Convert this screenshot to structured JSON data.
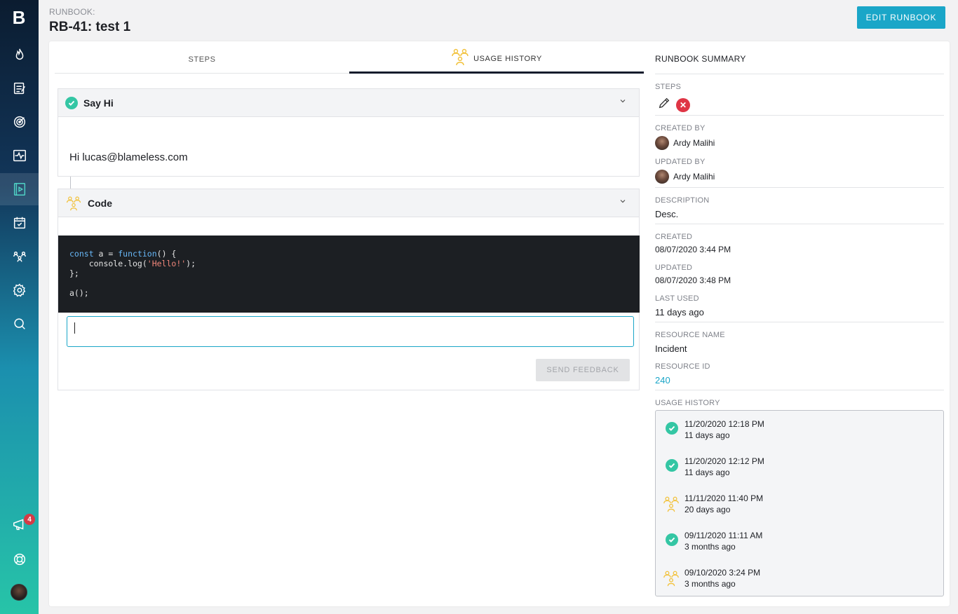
{
  "colors": {
    "accent": "#1aa6c8",
    "success": "#34c6a4",
    "danger": "#df3545",
    "warning_icon": "#f2c23c"
  },
  "sidebar": {
    "logo": "B",
    "items": [
      {
        "icon": "flame-icon"
      },
      {
        "icon": "notes-icon"
      },
      {
        "icon": "target-icon"
      },
      {
        "icon": "pulse-icon"
      },
      {
        "icon": "runbook-icon",
        "active": true
      },
      {
        "icon": "calendar-check-icon"
      },
      {
        "icon": "team-icon"
      },
      {
        "icon": "gear-icon"
      },
      {
        "icon": "search-icon"
      },
      {
        "icon": "megaphone-icon"
      },
      {
        "icon": "lifebuoy-icon"
      }
    ],
    "notification_count": "4"
  },
  "header": {
    "label": "RUNBOOK:",
    "title": "RB-41: test 1",
    "edit_button": "EDIT RUNBOOK"
  },
  "tabs": {
    "steps": "STEPS",
    "usage_history": "USAGE HISTORY"
  },
  "steps": {
    "step1": {
      "title": "Say Hi",
      "content": "Hi lucas@blameless.com"
    },
    "step2": {
      "title": "Code",
      "code_lines": [
        "const a = function() {",
        "    console.log('Hello!');",
        "};",
        "",
        "a();"
      ],
      "feedback_value": "",
      "send_button": "SEND FEEDBACK"
    }
  },
  "summary": {
    "heading": "RUNBOOK SUMMARY",
    "steps_label": "STEPS",
    "created_by_label": "CREATED BY",
    "created_by": "Ardy Malihi",
    "updated_by_label": "UPDATED BY",
    "updated_by": "Ardy Malihi",
    "description_label": "DESCRIPTION",
    "description": "Desc.",
    "created_label": "CREATED",
    "created": "08/07/2020 3:44 PM",
    "updated_label": "UPDATED",
    "updated": "08/07/2020 3:48 PM",
    "last_used_label": "LAST USED",
    "last_used": "11 days ago",
    "resource_name_label": "RESOURCE NAME",
    "resource_name": "Incident",
    "resource_id_label": "RESOURCE ID",
    "resource_id": "240",
    "usage_history_label": "USAGE HISTORY",
    "usage_history": [
      {
        "status": "success",
        "date": "11/20/2020 12:18 PM",
        "ago": "11 days ago"
      },
      {
        "status": "success",
        "date": "11/20/2020 12:12 PM",
        "ago": "11 days ago"
      },
      {
        "status": "in-progress",
        "date": "11/11/2020 11:40 PM",
        "ago": "20 days ago"
      },
      {
        "status": "success",
        "date": "09/11/2020 11:11 AM",
        "ago": "3 months ago"
      },
      {
        "status": "in-progress",
        "date": "09/10/2020 3:24 PM",
        "ago": "3 months ago"
      }
    ]
  }
}
